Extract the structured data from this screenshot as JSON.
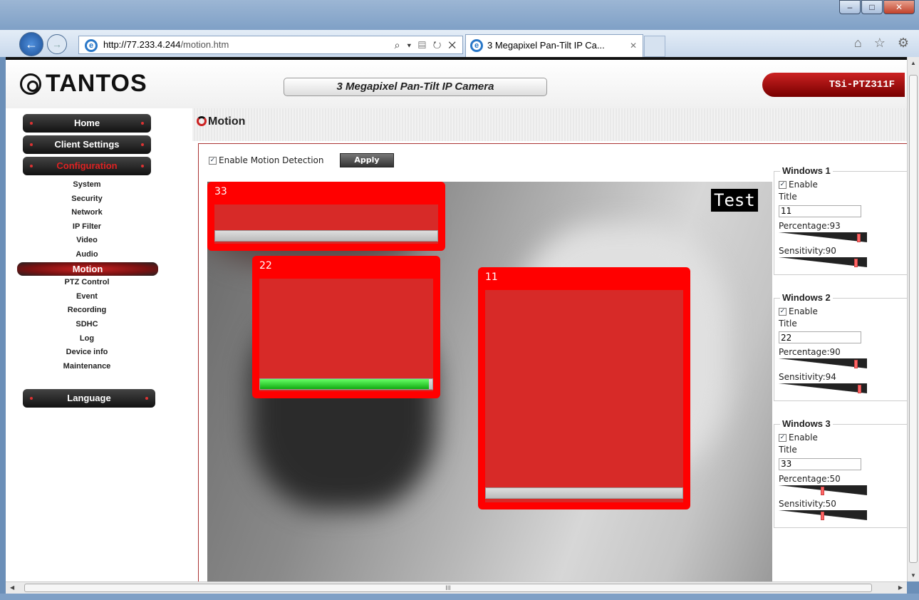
{
  "browser": {
    "address_host": "http://77.233.4.244",
    "address_path": "/motion.htm",
    "address_tools": "⌕ ▾ ▤ ↻ ✕",
    "tab_title": "3 Megapixel Pan-Tilt IP Ca...",
    "tab_close": "✕",
    "window_buttons": {
      "minimize": "–",
      "maximize": "□",
      "close": "✕"
    },
    "right_icons": "⌂ ☆ ⚙",
    "hscroll_grip": "III"
  },
  "header": {
    "logo": "TANTOS",
    "camera_title": "3 Megapixel Pan-Tilt IP Camera",
    "model": "TSi-PTZ311F"
  },
  "sidebar": {
    "home": "Home",
    "client_settings": "Client Settings",
    "configuration": "Configuration",
    "items": [
      "System",
      "Security",
      "Network",
      "IP Filter",
      "Video",
      "Audio",
      "Motion",
      "PTZ Control",
      "Event",
      "Recording",
      "SDHC",
      "Log",
      "Device info",
      "Maintenance"
    ],
    "language": "Language"
  },
  "page": {
    "title": "Motion",
    "enable_motion_label": "Enable Motion Detection",
    "enable_motion_checked": true,
    "apply_label": "Apply"
  },
  "video": {
    "osd_text": "Test",
    "windows": [
      {
        "label": "33",
        "level": 0.0
      },
      {
        "label": "22",
        "level": 0.98
      },
      {
        "label": "11",
        "level": 0.0
      }
    ]
  },
  "settings": {
    "groups": [
      {
        "legend": "Windows 1",
        "enable_label": "Enable",
        "title_label": "Title",
        "title_value": "11",
        "percentage_label": "Percentage:93",
        "percentage": 93,
        "sensitivity_label": "Sensitivity:90",
        "sensitivity": 90
      },
      {
        "legend": "Windows 2",
        "enable_label": "Enable",
        "title_label": "Title",
        "title_value": "22",
        "percentage_label": "Percentage:90",
        "percentage": 90,
        "sensitivity_label": "Sensitivity:94",
        "sensitivity": 94
      },
      {
        "legend": "Windows 3",
        "enable_label": "Enable",
        "title_label": "Title",
        "title_value": "33",
        "percentage_label": "Percentage:50",
        "percentage": 50,
        "sensitivity_label": "Sensitivity:50",
        "sensitivity": 50
      }
    ]
  },
  "colors": {
    "accent": "#cc2222",
    "motion_window": "#ff0000",
    "level_fill": "#22bb22"
  }
}
